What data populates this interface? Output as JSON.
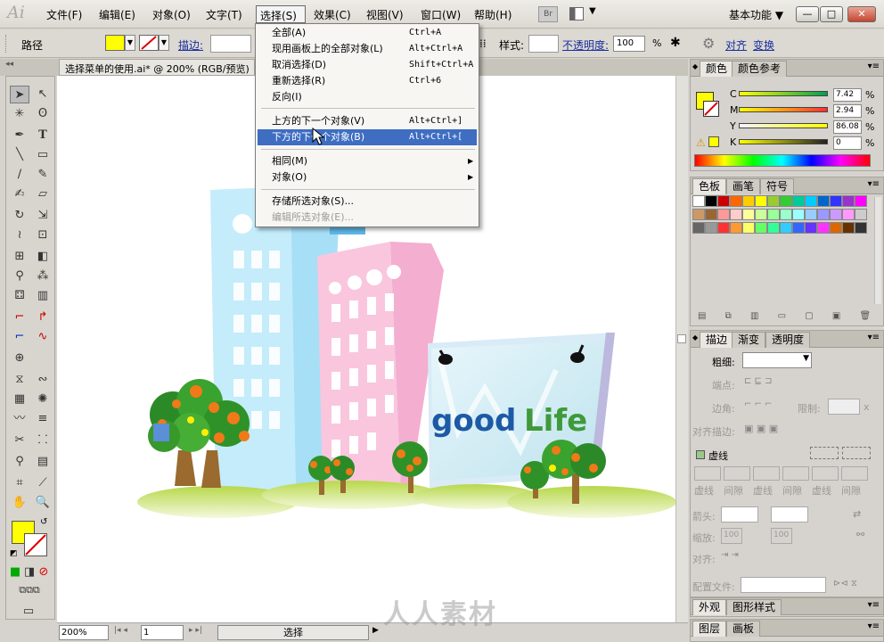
{
  "app": {
    "logo": "Ai",
    "workspace": "基本功能"
  },
  "menubar": [
    {
      "label": "文件(F)"
    },
    {
      "label": "编辑(E)"
    },
    {
      "label": "对象(O)"
    },
    {
      "label": "文字(T)"
    },
    {
      "label": "选择(S)"
    },
    {
      "label": "效果(C)"
    },
    {
      "label": "视图(V)"
    },
    {
      "label": "窗口(W)"
    },
    {
      "label": "帮助(H)"
    }
  ],
  "window_buttons": {
    "minimize": "—",
    "restore": "□",
    "close": "✕"
  },
  "control_bar": {
    "selection_label": "路径",
    "stroke_label": "描边:",
    "style_label": "样式:",
    "opacity_label": "不透明度:",
    "opacity_value": "100",
    "percent": "%",
    "align_link": "对齐",
    "transform_link": "变换",
    "fill_color": "#ffff00"
  },
  "document": {
    "tab_title": "选择菜单的使用.ai* @ 200% (RGB/预览)"
  },
  "select_menu": {
    "items": [
      {
        "label": "全部(A)",
        "shortcut": "Ctrl+A",
        "state": "normal"
      },
      {
        "label": "现用画板上的全部对象(L)",
        "shortcut": "Alt+Ctrl+A",
        "state": "normal"
      },
      {
        "label": "取消选择(D)",
        "shortcut": "Shift+Ctrl+A",
        "state": "normal"
      },
      {
        "label": "重新选择(R)",
        "shortcut": "Ctrl+6",
        "state": "normal"
      },
      {
        "label": "反向(I)",
        "shortcut": "",
        "state": "normal"
      },
      {
        "label": "上方的下一个对象(V)",
        "shortcut": "Alt+Ctrl+]",
        "state": "normal"
      },
      {
        "label": "下方的下一个对象(B)",
        "shortcut": "Alt+Ctrl+[",
        "state": "highlighted"
      },
      {
        "label": "相同(M)",
        "shortcut": "",
        "state": "submenu"
      },
      {
        "label": "对象(O)",
        "shortcut": "",
        "state": "submenu"
      },
      {
        "label": "存储所选对象(S)...",
        "shortcut": "",
        "state": "normal"
      },
      {
        "label": "编辑所选对象(E)...",
        "shortcut": "",
        "state": "disabled"
      }
    ]
  },
  "artwork": {
    "logo_good": "good",
    "logo_life": "Life"
  },
  "status_bar": {
    "zoom": "200%",
    "page": "1",
    "tool": "选择"
  },
  "color_panel": {
    "tabs": [
      "颜色",
      "颜色参考"
    ],
    "channels": [
      {
        "label": "C",
        "value": "7.42"
      },
      {
        "label": "M",
        "value": "2.94"
      },
      {
        "label": "Y",
        "value": "86.08"
      },
      {
        "label": "K",
        "value": "0"
      }
    ],
    "percent": "%"
  },
  "swatches_panel": {
    "tabs": [
      "色板",
      "画笔",
      "符号"
    ]
  },
  "stroke_panel": {
    "tabs": [
      "描边",
      "渐变",
      "透明度"
    ],
    "weight_label": "粗细:",
    "cap_label": "端点:",
    "corner_label": "边角:",
    "limit_label": "限制:",
    "limit_unit": "x",
    "align_label": "对齐描边:",
    "dashed_label": "虚线",
    "dash_labels": [
      "虚线",
      "间隙",
      "虚线",
      "间隙",
      "虚线",
      "间隙"
    ],
    "arrowheads_label": "箭头:",
    "scale_label": "缩放:",
    "scale_values": [
      "100",
      "100"
    ],
    "align_label2": "对齐:",
    "profile_label": "配置文件:"
  },
  "appearance_panel": {
    "tabs": [
      "外观",
      "图形样式"
    ]
  },
  "layers_panel": {
    "tabs": [
      "图层",
      "画板"
    ]
  },
  "watermark": "人人素材"
}
